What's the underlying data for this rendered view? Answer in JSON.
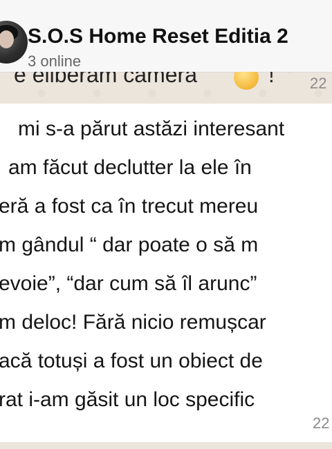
{
  "chat": {
    "title": "S.O.S Home Reset Editia 2",
    "status": "3 online"
  },
  "previous_message": {
    "text_fragment": "e eliberăm camera",
    "emoji": "smiling-face",
    "punctuation": "!",
    "time_fragment": "22"
  },
  "message": {
    "lines": [
      "mi s-a părut astăzi interesant",
      "am făcut declutter la ele în",
      "eră a fost ca în trecut mereu",
      "m gândul “ dar poate o să m",
      "evoie”, “dar cum să îl arunc”",
      "m deloc! Fără nicio remușcar",
      "acă totuși a fost un obiect de",
      "rat i-am găsit un loc specific"
    ],
    "time_fragment": "22"
  },
  "colors": {
    "background": "#ece5dc",
    "header": "#f7f7f7",
    "bubble": "#ffffff",
    "timestamp": "#8a8a8a"
  }
}
